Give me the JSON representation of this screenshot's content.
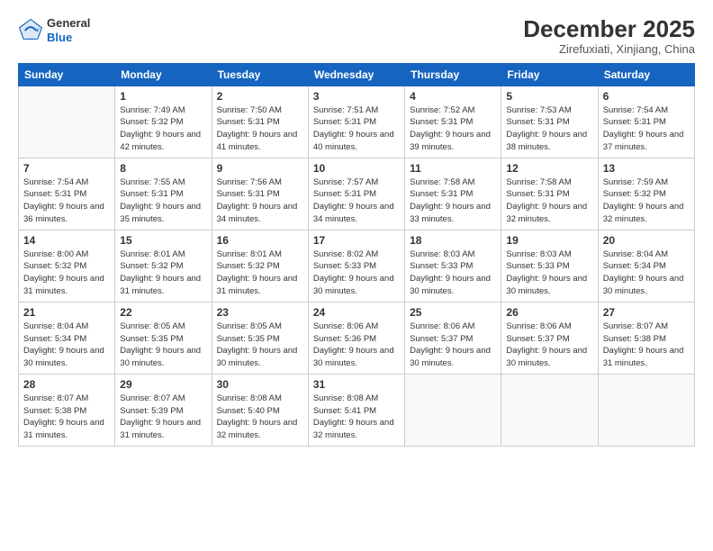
{
  "logo": {
    "general": "General",
    "blue": "Blue"
  },
  "title": "December 2025",
  "location": "Zirefuxiati, Xinjiang, China",
  "days_of_week": [
    "Sunday",
    "Monday",
    "Tuesday",
    "Wednesday",
    "Thursday",
    "Friday",
    "Saturday"
  ],
  "weeks": [
    [
      {
        "day": "",
        "sunrise": "",
        "sunset": "",
        "daylight": ""
      },
      {
        "day": "1",
        "sunrise": "Sunrise: 7:49 AM",
        "sunset": "Sunset: 5:32 PM",
        "daylight": "Daylight: 9 hours and 42 minutes."
      },
      {
        "day": "2",
        "sunrise": "Sunrise: 7:50 AM",
        "sunset": "Sunset: 5:31 PM",
        "daylight": "Daylight: 9 hours and 41 minutes."
      },
      {
        "day": "3",
        "sunrise": "Sunrise: 7:51 AM",
        "sunset": "Sunset: 5:31 PM",
        "daylight": "Daylight: 9 hours and 40 minutes."
      },
      {
        "day": "4",
        "sunrise": "Sunrise: 7:52 AM",
        "sunset": "Sunset: 5:31 PM",
        "daylight": "Daylight: 9 hours and 39 minutes."
      },
      {
        "day": "5",
        "sunrise": "Sunrise: 7:53 AM",
        "sunset": "Sunset: 5:31 PM",
        "daylight": "Daylight: 9 hours and 38 minutes."
      },
      {
        "day": "6",
        "sunrise": "Sunrise: 7:54 AM",
        "sunset": "Sunset: 5:31 PM",
        "daylight": "Daylight: 9 hours and 37 minutes."
      }
    ],
    [
      {
        "day": "7",
        "sunrise": "Sunrise: 7:54 AM",
        "sunset": "Sunset: 5:31 PM",
        "daylight": "Daylight: 9 hours and 36 minutes."
      },
      {
        "day": "8",
        "sunrise": "Sunrise: 7:55 AM",
        "sunset": "Sunset: 5:31 PM",
        "daylight": "Daylight: 9 hours and 35 minutes."
      },
      {
        "day": "9",
        "sunrise": "Sunrise: 7:56 AM",
        "sunset": "Sunset: 5:31 PM",
        "daylight": "Daylight: 9 hours and 34 minutes."
      },
      {
        "day": "10",
        "sunrise": "Sunrise: 7:57 AM",
        "sunset": "Sunset: 5:31 PM",
        "daylight": "Daylight: 9 hours and 34 minutes."
      },
      {
        "day": "11",
        "sunrise": "Sunrise: 7:58 AM",
        "sunset": "Sunset: 5:31 PM",
        "daylight": "Daylight: 9 hours and 33 minutes."
      },
      {
        "day": "12",
        "sunrise": "Sunrise: 7:58 AM",
        "sunset": "Sunset: 5:31 PM",
        "daylight": "Daylight: 9 hours and 32 minutes."
      },
      {
        "day": "13",
        "sunrise": "Sunrise: 7:59 AM",
        "sunset": "Sunset: 5:32 PM",
        "daylight": "Daylight: 9 hours and 32 minutes."
      }
    ],
    [
      {
        "day": "14",
        "sunrise": "Sunrise: 8:00 AM",
        "sunset": "Sunset: 5:32 PM",
        "daylight": "Daylight: 9 hours and 31 minutes."
      },
      {
        "day": "15",
        "sunrise": "Sunrise: 8:01 AM",
        "sunset": "Sunset: 5:32 PM",
        "daylight": "Daylight: 9 hours and 31 minutes."
      },
      {
        "day": "16",
        "sunrise": "Sunrise: 8:01 AM",
        "sunset": "Sunset: 5:32 PM",
        "daylight": "Daylight: 9 hours and 31 minutes."
      },
      {
        "day": "17",
        "sunrise": "Sunrise: 8:02 AM",
        "sunset": "Sunset: 5:33 PM",
        "daylight": "Daylight: 9 hours and 30 minutes."
      },
      {
        "day": "18",
        "sunrise": "Sunrise: 8:03 AM",
        "sunset": "Sunset: 5:33 PM",
        "daylight": "Daylight: 9 hours and 30 minutes."
      },
      {
        "day": "19",
        "sunrise": "Sunrise: 8:03 AM",
        "sunset": "Sunset: 5:33 PM",
        "daylight": "Daylight: 9 hours and 30 minutes."
      },
      {
        "day": "20",
        "sunrise": "Sunrise: 8:04 AM",
        "sunset": "Sunset: 5:34 PM",
        "daylight": "Daylight: 9 hours and 30 minutes."
      }
    ],
    [
      {
        "day": "21",
        "sunrise": "Sunrise: 8:04 AM",
        "sunset": "Sunset: 5:34 PM",
        "daylight": "Daylight: 9 hours and 30 minutes."
      },
      {
        "day": "22",
        "sunrise": "Sunrise: 8:05 AM",
        "sunset": "Sunset: 5:35 PM",
        "daylight": "Daylight: 9 hours and 30 minutes."
      },
      {
        "day": "23",
        "sunrise": "Sunrise: 8:05 AM",
        "sunset": "Sunset: 5:35 PM",
        "daylight": "Daylight: 9 hours and 30 minutes."
      },
      {
        "day": "24",
        "sunrise": "Sunrise: 8:06 AM",
        "sunset": "Sunset: 5:36 PM",
        "daylight": "Daylight: 9 hours and 30 minutes."
      },
      {
        "day": "25",
        "sunrise": "Sunrise: 8:06 AM",
        "sunset": "Sunset: 5:37 PM",
        "daylight": "Daylight: 9 hours and 30 minutes."
      },
      {
        "day": "26",
        "sunrise": "Sunrise: 8:06 AM",
        "sunset": "Sunset: 5:37 PM",
        "daylight": "Daylight: 9 hours and 30 minutes."
      },
      {
        "day": "27",
        "sunrise": "Sunrise: 8:07 AM",
        "sunset": "Sunset: 5:38 PM",
        "daylight": "Daylight: 9 hours and 31 minutes."
      }
    ],
    [
      {
        "day": "28",
        "sunrise": "Sunrise: 8:07 AM",
        "sunset": "Sunset: 5:38 PM",
        "daylight": "Daylight: 9 hours and 31 minutes."
      },
      {
        "day": "29",
        "sunrise": "Sunrise: 8:07 AM",
        "sunset": "Sunset: 5:39 PM",
        "daylight": "Daylight: 9 hours and 31 minutes."
      },
      {
        "day": "30",
        "sunrise": "Sunrise: 8:08 AM",
        "sunset": "Sunset: 5:40 PM",
        "daylight": "Daylight: 9 hours and 32 minutes."
      },
      {
        "day": "31",
        "sunrise": "Sunrise: 8:08 AM",
        "sunset": "Sunset: 5:41 PM",
        "daylight": "Daylight: 9 hours and 32 minutes."
      },
      {
        "day": "",
        "sunrise": "",
        "sunset": "",
        "daylight": ""
      },
      {
        "day": "",
        "sunrise": "",
        "sunset": "",
        "daylight": ""
      },
      {
        "day": "",
        "sunrise": "",
        "sunset": "",
        "daylight": ""
      }
    ]
  ]
}
